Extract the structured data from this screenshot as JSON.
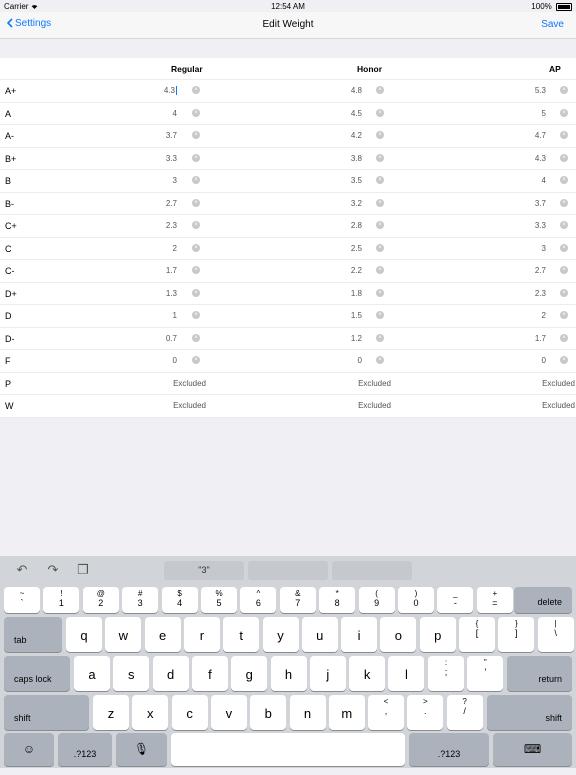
{
  "status": {
    "carrier": "Carrier",
    "time": "12:54 AM",
    "battery": "100%"
  },
  "nav": {
    "back_label": "Settings",
    "title": "Edit Weight",
    "save_label": "Save"
  },
  "table": {
    "headers": [
      "Regular",
      "Honor",
      "AP"
    ],
    "rows": [
      {
        "grade": "A+",
        "regular": "4.3",
        "honor": "4.8",
        "ap": "5.3"
      },
      {
        "grade": "A",
        "regular": "4",
        "honor": "4.5",
        "ap": "5"
      },
      {
        "grade": "A-",
        "regular": "3.7",
        "honor": "4.2",
        "ap": "4.7"
      },
      {
        "grade": "B+",
        "regular": "3.3",
        "honor": "3.8",
        "ap": "4.3"
      },
      {
        "grade": "B",
        "regular": "3",
        "honor": "3.5",
        "ap": "4"
      },
      {
        "grade": "B-",
        "regular": "2.7",
        "honor": "3.2",
        "ap": "3.7"
      },
      {
        "grade": "C+",
        "regular": "2.3",
        "honor": "2.8",
        "ap": "3.3"
      },
      {
        "grade": "C",
        "regular": "2",
        "honor": "2.5",
        "ap": "3"
      },
      {
        "grade": "C-",
        "regular": "1.7",
        "honor": "2.2",
        "ap": "2.7"
      },
      {
        "grade": "D+",
        "regular": "1.3",
        "honor": "1.8",
        "ap": "2.3"
      },
      {
        "grade": "D",
        "regular": "1",
        "honor": "1.5",
        "ap": "2"
      },
      {
        "grade": "D-",
        "regular": "0.7",
        "honor": "1.2",
        "ap": "1.7"
      },
      {
        "grade": "F",
        "regular": "0",
        "honor": "0",
        "ap": "0"
      },
      {
        "grade": "P",
        "regular": "Excluded",
        "honor": "Excluded",
        "ap": "Excluded"
      },
      {
        "grade": "W",
        "regular": "Excluded",
        "honor": "Excluded",
        "ap": "Excluded"
      }
    ]
  },
  "keyboard": {
    "suggestions": [
      "\"3\"",
      "",
      ""
    ],
    "row1": [
      {
        "up": "~",
        "lo": "`"
      },
      {
        "up": "!",
        "lo": "1"
      },
      {
        "up": "@",
        "lo": "2"
      },
      {
        "up": "#",
        "lo": "3"
      },
      {
        "up": "$",
        "lo": "4"
      },
      {
        "up": "%",
        "lo": "5"
      },
      {
        "up": "^",
        "lo": "6"
      },
      {
        "up": "&",
        "lo": "7"
      },
      {
        "up": "*",
        "lo": "8"
      },
      {
        "up": "(",
        "lo": "9"
      },
      {
        "up": ")",
        "lo": "0"
      },
      {
        "up": "_",
        "lo": "-"
      },
      {
        "up": "+",
        "lo": "="
      }
    ],
    "delete": "delete",
    "tab": "tab",
    "row2": [
      "q",
      "w",
      "e",
      "r",
      "t",
      "y",
      "u",
      "i",
      "o",
      "p"
    ],
    "row2_sym": [
      {
        "up": "{",
        "lo": "["
      },
      {
        "up": "}",
        "lo": "]"
      },
      {
        "up": "|",
        "lo": "\\"
      }
    ],
    "caps": "caps lock",
    "row3": [
      "a",
      "s",
      "d",
      "f",
      "g",
      "h",
      "j",
      "k",
      "l"
    ],
    "row3_sym": [
      {
        "up": ":",
        "lo": ";"
      },
      {
        "up": "\"",
        "lo": "'"
      }
    ],
    "return": "return",
    "shift": "shift",
    "row4": [
      "z",
      "x",
      "c",
      "v",
      "b",
      "n",
      "m"
    ],
    "row4_sym": [
      {
        "up": "<",
        "lo": ","
      },
      {
        "up": ">",
        "lo": "."
      },
      {
        "up": "?",
        "lo": "/"
      }
    ],
    "numbers_label": ".?123",
    "accent_color": "#0a7aff"
  }
}
